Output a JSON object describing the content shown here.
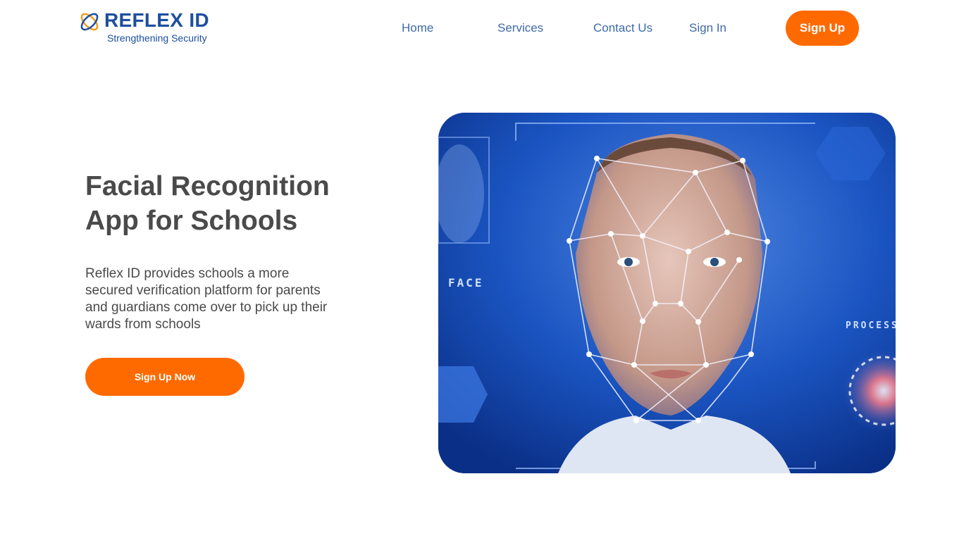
{
  "brand": {
    "name": "REFLEX ID",
    "tagline": "Strengthening Security",
    "primary_color": "#1d4fa0",
    "accent_color": "#ff6a00"
  },
  "nav": {
    "items": [
      {
        "label": "Home"
      },
      {
        "label": "Services"
      },
      {
        "label": "Contact Us"
      },
      {
        "label": "Sign In"
      }
    ],
    "signup_label": "Sign Up"
  },
  "hero": {
    "title": "Facial Recognition App for Schools",
    "description": "Reflex ID provides schools a more secured verification platform for parents and guardians come over to pick up their wards from schools",
    "cta_label": "Sign Up Now",
    "image": {
      "subject": "face-recognition-scan-image",
      "overlay_labels": [
        "FACE",
        "PROCESS"
      ]
    }
  }
}
